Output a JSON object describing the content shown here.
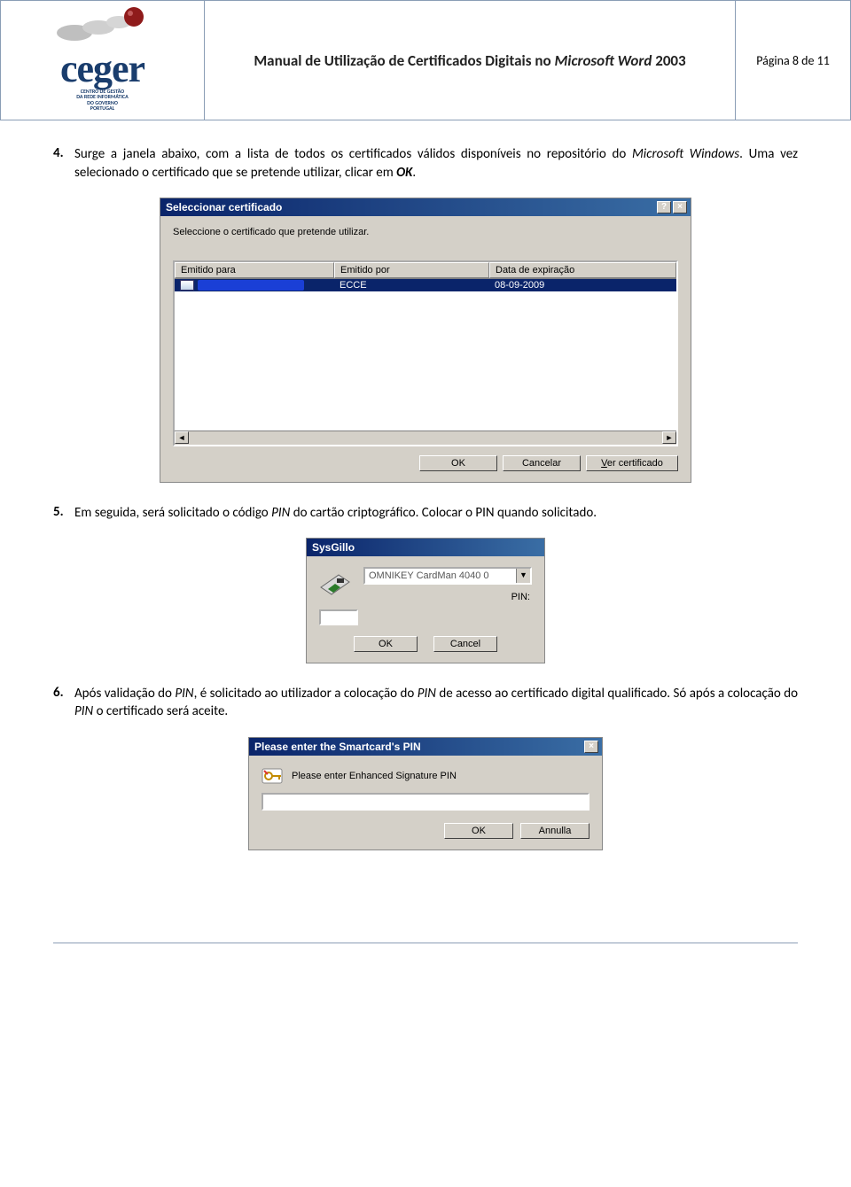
{
  "header": {
    "doc_title_a": "Manual de Utilização de Certificados Digitais no ",
    "doc_title_b": "Microsoft Word",
    "doc_title_c": " 2003",
    "page_label": "Página 8 de 11",
    "logo_word": "ceger",
    "logo_sub1": "CENTRO DE GESTÃO",
    "logo_sub2": "DA REDE INFORMÁTICA",
    "logo_sub3": "DO GOVERNO",
    "logo_sub4": "PORTUGAL"
  },
  "steps": {
    "s4": {
      "num": "4.",
      "text_a": "Surge a janela abaixo, com a lista de todos os certificados válidos disponíveis no repositório do ",
      "text_b": "Microsoft Windows",
      "text_c": ". Uma vez selecionado o certificado que se pretende utilizar, clicar em ",
      "text_d": "OK",
      "text_e": "."
    },
    "s5": {
      "num": "5.",
      "text_a": "Em seguida, será solicitado o código ",
      "text_b": "PIN",
      "text_c": " do cartão criptográfico. Colocar o PIN quando solicitado."
    },
    "s6": {
      "num": "6.",
      "text_a": "Após validação do ",
      "text_b": "PIN",
      "text_c": ", é solicitado ao utilizador a colocação do ",
      "text_d": "PIN",
      "text_e": " de acesso ao certificado digital qualificado. Só após a colocação do ",
      "text_f": "PIN",
      "text_g": " o certificado será aceite."
    }
  },
  "dlg1": {
    "title": "Seleccionar certificado",
    "help_btn": "?",
    "close_btn": "×",
    "instruction": "Seleccione o certificado que pretende utilizar.",
    "col_a": "Emitido para",
    "col_b": "Emitido por",
    "col_c": "Data de expiração",
    "row_b": "ECCE",
    "row_c": "08-09-2009",
    "scroll_left": "◄",
    "scroll_right": "►",
    "btn_ok": "OK",
    "btn_cancel": "Cancelar",
    "btn_view": "Ver certificado"
  },
  "dlg2": {
    "title": "SysGillo",
    "reader": "OMNIKEY CardMan 4040 0",
    "combo_caret": "▼",
    "pin_label": "PIN:",
    "btn_ok": "OK",
    "btn_cancel": "Cancel"
  },
  "dlg3": {
    "title": "Please enter the Smartcard's PIN",
    "close_btn": "×",
    "prompt": "Please enter Enhanced Signature PIN",
    "btn_ok": "OK",
    "btn_cancel": "Annulla"
  }
}
